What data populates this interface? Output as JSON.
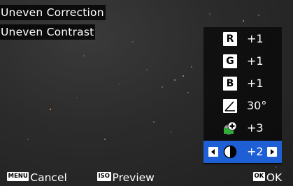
{
  "screen": {
    "title": "Uneven Correction",
    "subtitle": "Uneven Contrast"
  },
  "panel": {
    "rows": [
      {
        "icon": "red-channel-icon",
        "letter": "R",
        "value": "+1"
      },
      {
        "icon": "green-channel-icon",
        "letter": "G",
        "value": "+1"
      },
      {
        "icon": "blue-channel-icon",
        "letter": "B",
        "value": "+1"
      },
      {
        "icon": "angle-icon",
        "value": "30°"
      },
      {
        "icon": "saturation-plus-icon",
        "value": "+3"
      },
      {
        "icon": "contrast-icon",
        "value": "+2",
        "selected": true
      }
    ]
  },
  "footer": {
    "cancel_key": "MENU",
    "cancel_label": "Cancel",
    "preview_key": "ISO",
    "preview_label": "Preview",
    "ok_key": "OK",
    "ok_label": "OK"
  },
  "colors": {
    "selection": "#1f5fd6",
    "background": "#2b2b2b"
  }
}
